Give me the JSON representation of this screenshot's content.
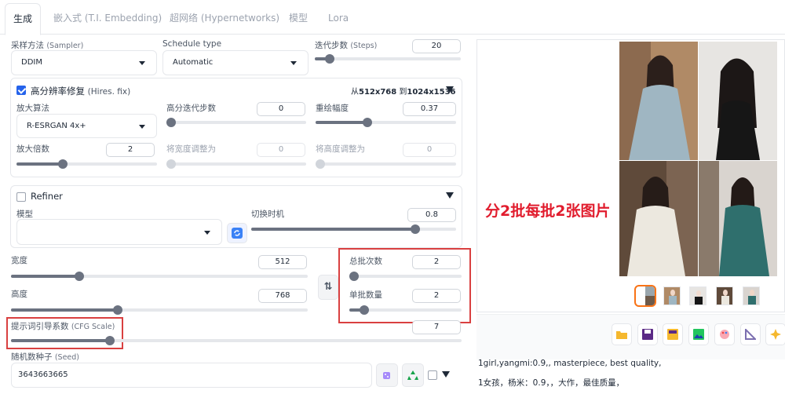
{
  "tabs": [
    {
      "label": "生成",
      "active": true
    },
    {
      "label": "嵌入式 (T.I. Embedding)"
    },
    {
      "label": "超网络 (Hypernetworks)"
    },
    {
      "label": "模型"
    },
    {
      "label": "Lora"
    }
  ],
  "sampler": {
    "label": "采样方法",
    "hint": "(Sampler)",
    "value": "DDIM"
  },
  "schedule": {
    "label": "Schedule type",
    "value": "Automatic"
  },
  "steps": {
    "label": "迭代步数",
    "hint": "(Steps)",
    "value": "20",
    "fraction": 0.1
  },
  "hires": {
    "label": "高分辨率修复",
    "hint": "(Hires. fix)",
    "enabled": true,
    "info_prefix": "从",
    "info_from": "512x768",
    "info_mid": " 到",
    "info_to": "1024x1536",
    "upscaler_label": "放大算法",
    "upscaler_value": "R-ESRGAN 4x+",
    "hires_steps_label": "高分迭代步数",
    "hires_steps_value": "0",
    "hires_steps_fraction": 0.0,
    "denoise_label": "重绘幅度",
    "denoise_value": "0.37",
    "denoise_fraction": 0.37,
    "scale_label": "放大倍数",
    "scale_value": "2",
    "scale_fraction": 0.33,
    "resize_w_label": "将宽度调整为",
    "resize_w_value": "0",
    "resize_h_label": "将高度调整为",
    "resize_h_value": "0"
  },
  "refiner": {
    "label": "Refiner",
    "enabled": false,
    "model_label": "模型",
    "model_value": "",
    "switch_label": "切换时机",
    "switch_value": "0.8",
    "switch_fraction": 0.8
  },
  "width": {
    "label": "宽度",
    "value": "512",
    "fraction": 0.23
  },
  "height": {
    "label": "高度",
    "value": "768",
    "fraction": 0.36
  },
  "swap_icon": "⇅",
  "batch_count": {
    "label": "总批次数",
    "value": "2",
    "fraction": 0.01
  },
  "batch_size": {
    "label": "单批数量",
    "value": "2",
    "fraction": 0.13
  },
  "cfg": {
    "label": "提示词引导系数",
    "hint": "(CFG Scale)",
    "value": "7",
    "fraction": 0.22
  },
  "seed": {
    "label": "随机数种子",
    "hint": "(Seed)",
    "value": "3643663665"
  },
  "caption": "分2批每批2张图片",
  "prompt_text": "1girl,yangmi:0.9,, masterpiece, best quality,",
  "prompt_translation": "1女孩，杨米：0.9，，大作，最佳质量，",
  "colors": {
    "accent_red": "#d94040",
    "caption_red": "#e11d2e",
    "checkbox_blue": "#2563eb",
    "selected_thumb": "#f97316"
  },
  "icons": {
    "refresh": "refresh-icon",
    "dice": "dice-icon",
    "recycle": "recycle-icon",
    "tools": [
      "folder-icon",
      "save-icon",
      "zip-icon",
      "image-icon",
      "palette-icon",
      "ruler-icon",
      "sparkle-icon"
    ]
  }
}
